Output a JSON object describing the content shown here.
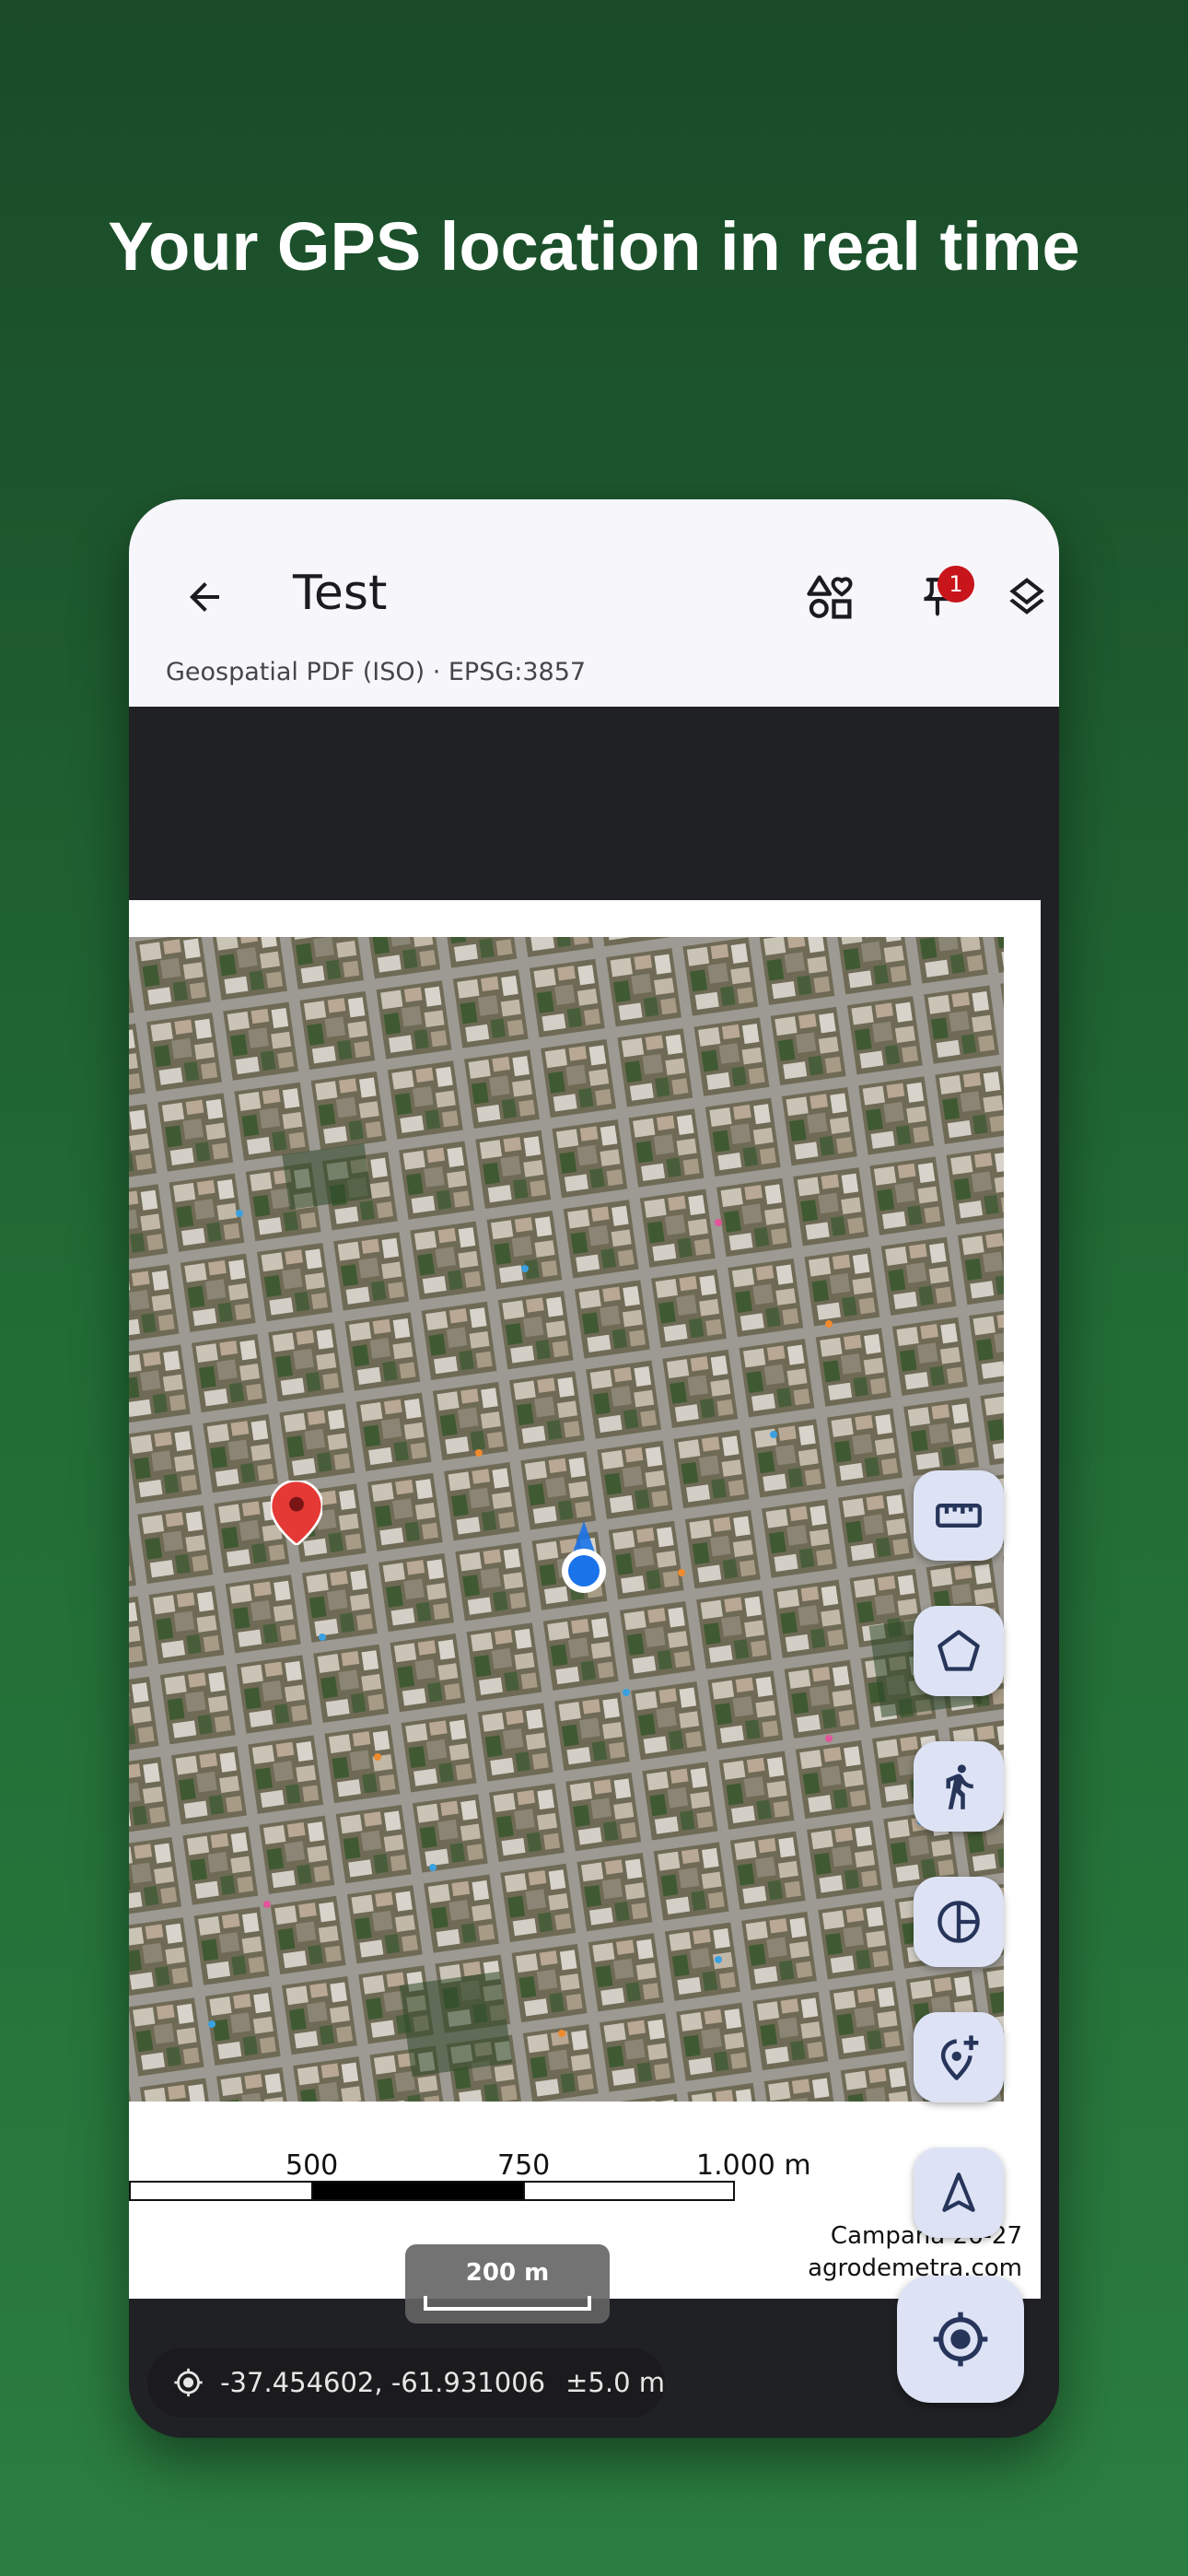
{
  "headline": "Your GPS location in real time",
  "appbar": {
    "title": "Test",
    "subtitle": "Geospatial PDF (ISO) · EPSG:3857",
    "pins_badge_count": "1"
  },
  "map": {
    "scale_labels": [
      "500",
      "750",
      "1.000 m"
    ],
    "credits_line1": "Campaña 26-27",
    "credits_line2": "agrodemetra.com",
    "scale_chip_label": "200 m"
  },
  "status": {
    "coordinates": "-37.454602, -61.931006",
    "accuracy": "±5.0 m"
  },
  "tools": [
    {
      "name": "measure-distance",
      "icon": "ruler-icon"
    },
    {
      "name": "measure-area",
      "icon": "pentagon-icon"
    },
    {
      "name": "track-walk",
      "icon": "walk-icon"
    },
    {
      "name": "sample-zones",
      "icon": "pie-chart-icon"
    },
    {
      "name": "add-placemark",
      "icon": "add-location-icon"
    },
    {
      "name": "navigate",
      "icon": "navigation-arrow-icon"
    }
  ],
  "colors": {
    "background_top": "#1a4a28",
    "background_bottom": "#2b7d40",
    "fab_background": "#dde3f5",
    "fab_icon": "#27355a",
    "badge": "#c8141b",
    "gps_dot": "#1a73e8",
    "placemark": "#e53935"
  }
}
